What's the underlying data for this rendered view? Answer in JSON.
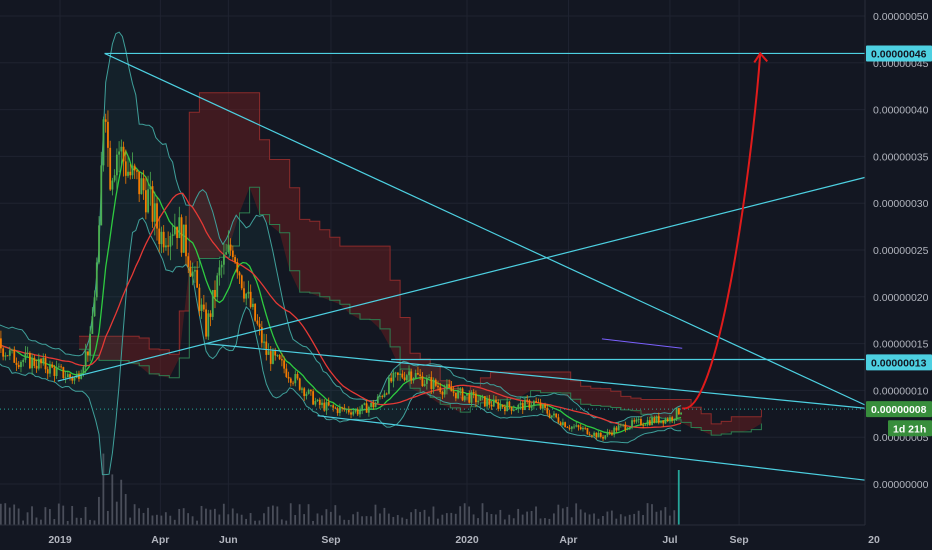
{
  "colors": {
    "background": "#131722",
    "grid": "#1f2330",
    "axis_text": "#b2b5be",
    "up": "#26a69a",
    "down": "#ef5350",
    "candle_up": "#4caf50",
    "candle_down": "#f57c00",
    "trendline": "#4dd0e1",
    "projection": "#e01b1b",
    "kumo_bear": "#5c1a1a",
    "kumo_bull": "#1b3d2a",
    "ma_fast": "#2ecc40",
    "ma_slow": "#e53935",
    "bollinger": "#3f9f9a",
    "ichimoku_lag": "#2e7d4f",
    "purple_line": "#7b61ff",
    "badge_price": "#4dd0e1",
    "badge_current": "#388e3c",
    "volume": "#4a4e5a"
  },
  "chart_data": {
    "type": "candlestick",
    "price_axis": {
      "min": 0,
      "max": 5e-07,
      "ticks": [
        "0.00000050",
        "0.00000045",
        "0.00000040",
        "0.00000035",
        "0.00000030",
        "0.00000025",
        "0.00000020",
        "0.00000015",
        "0.00000010",
        "0.00000005",
        "0.00000000"
      ],
      "tick_values": [
        5e-07,
        4.5e-07,
        4e-07,
        3.5e-07,
        3e-07,
        2.5e-07,
        2e-07,
        1.5e-07,
        1e-07,
        5e-08,
        0
      ]
    },
    "time_axis": {
      "start": "2018-11-01",
      "end": "2020-12-31",
      "labels": [
        {
          "text": "2019",
          "date": "2019-01-01"
        },
        {
          "text": "Apr",
          "date": "2019-04-01"
        },
        {
          "text": "Jun",
          "date": "2019-06-01"
        },
        {
          "text": "Sep",
          "date": "2019-09-01"
        },
        {
          "text": "2020",
          "date": "2020-01-01"
        },
        {
          "text": "Apr",
          "date": "2020-04-01"
        },
        {
          "text": "Jul",
          "date": "2020-07-01"
        },
        {
          "text": "Sep",
          "date": "2020-09-01"
        },
        {
          "text": "20",
          "date": "2020-12-31"
        }
      ]
    },
    "price_path": [
      [
        "2018-11-01",
        1.55e-07
      ],
      [
        "2018-11-20",
        1.35e-07
      ],
      [
        "2018-12-10",
        1.3e-07
      ],
      [
        "2018-12-30",
        1.2e-07
      ],
      [
        "2019-01-15",
        1.12e-07
      ],
      [
        "2019-01-28",
        1.5e-07
      ],
      [
        "2019-02-05",
        2.6e-07
      ],
      [
        "2019-02-10",
        4.4e-07
      ],
      [
        "2019-02-14",
        3.3e-07
      ],
      [
        "2019-02-22",
        3.6e-07
      ],
      [
        "2019-03-05",
        3.3e-07
      ],
      [
        "2019-03-20",
        3.1e-07
      ],
      [
        "2019-04-01",
        2.65e-07
      ],
      [
        "2019-04-15",
        2.8e-07
      ],
      [
        "2019-04-25",
        2.5e-07
      ],
      [
        "2019-05-05",
        2e-07
      ],
      [
        "2019-05-12",
        1.65e-07
      ],
      [
        "2019-05-25",
        2.3e-07
      ],
      [
        "2019-06-05",
        2.55e-07
      ],
      [
        "2019-06-15",
        2.1e-07
      ],
      [
        "2019-06-25",
        1.75e-07
      ],
      [
        "2019-07-05",
        1.4e-07
      ],
      [
        "2019-07-20",
        1.25e-07
      ],
      [
        "2019-08-05",
        1.05e-07
      ],
      [
        "2019-08-20",
        8.5e-08
      ],
      [
        "2019-09-05",
        8e-08
      ],
      [
        "2019-09-25",
        7.8e-08
      ],
      [
        "2019-10-10",
        8.5e-08
      ],
      [
        "2019-10-25",
        1.1e-07
      ],
      [
        "2019-11-10",
        1.2e-07
      ],
      [
        "2019-11-25",
        1.1e-07
      ],
      [
        "2019-12-15",
        1e-07
      ],
      [
        "2020-01-05",
        9.2e-08
      ],
      [
        "2020-01-25",
        8.5e-08
      ],
      [
        "2020-02-15",
        8.2e-08
      ],
      [
        "2020-03-01",
        8.7e-08
      ],
      [
        "2020-03-15",
        7.5e-08
      ],
      [
        "2020-04-01",
        6.2e-08
      ],
      [
        "2020-04-15",
        5.8e-08
      ],
      [
        "2020-05-01",
        5e-08
      ],
      [
        "2020-05-15",
        6e-08
      ],
      [
        "2020-06-01",
        6.5e-08
      ],
      [
        "2020-06-15",
        6.8e-08
      ],
      [
        "2020-07-01",
        7e-08
      ],
      [
        "2020-07-12",
        8.1e-08
      ]
    ],
    "trendlines": [
      {
        "from": [
          "2019-02-10",
          4.6e-07
        ],
        "to": [
          "2020-12-31",
          4.6e-07
        ]
      },
      {
        "from": [
          "2019-02-10",
          4.6e-07
        ],
        "to": [
          "2020-12-31",
          8e-08
        ]
      },
      {
        "from": [
          "2018-12-30",
          1.1e-07
        ],
        "to": [
          "2020-12-31",
          3.3e-07
        ]
      },
      {
        "from": [
          "2019-05-12",
          1.5e-07
        ],
        "to": [
          "2020-12-31",
          8e-08
        ]
      },
      {
        "from": [
          "2019-08-20",
          7.3e-08
        ],
        "to": [
          "2020-12-31",
          3e-09
        ]
      },
      {
        "from": [
          "2019-10-25",
          1.33e-07
        ],
        "to": [
          "2020-12-31",
          1.33e-07
        ]
      }
    ],
    "projection": {
      "from": [
        "2020-07-12",
        8.1e-08
      ],
      "to": [
        "2020-09-20",
        4.6e-07
      ]
    },
    "badges": [
      {
        "label": "0.00000046",
        "value": 4.6e-07,
        "style": "price"
      },
      {
        "label": "0.00000013",
        "value": 1.3e-07,
        "style": "price"
      },
      {
        "label": "0.00000008",
        "value": 8e-08,
        "style": "current"
      },
      {
        "label": "1d 21h",
        "value": 5.95e-08,
        "style": "countdown"
      }
    ],
    "current_price": 8e-08,
    "purple_segment": {
      "from": [
        "2020-05-01",
        1.55e-07
      ],
      "to": [
        "2020-07-12",
        1.45e-07
      ]
    }
  }
}
